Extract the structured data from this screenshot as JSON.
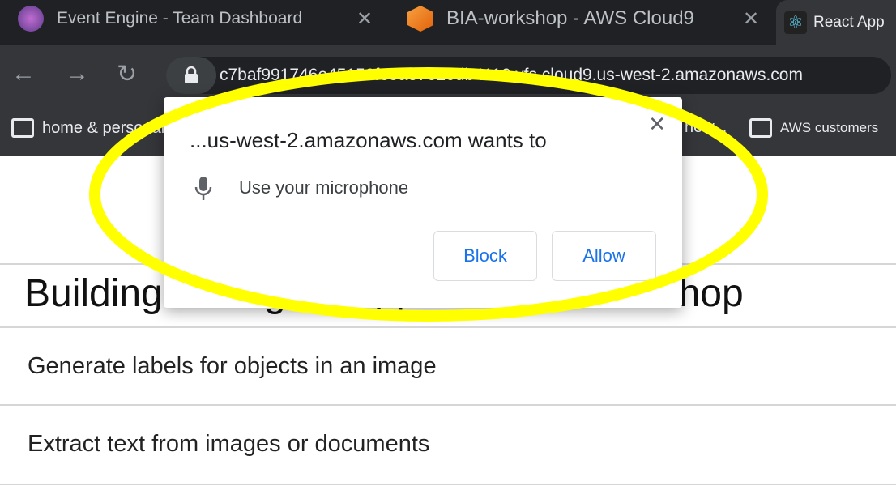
{
  "tabs": [
    {
      "title": "Event Engine - Team Dashboard",
      "icon": "event-engine-favicon"
    },
    {
      "title": "BIA-workshop - AWS Cloud9",
      "icon": "cloud9-favicon"
    },
    {
      "title": "React App",
      "icon": "react-favicon",
      "active": true
    }
  ],
  "address_bar": {
    "url": "c7baf991746e45159fe5ae7610db4116.vfs.cloud9.us-west-2.amazonaws.com"
  },
  "bookmarks": [
    {
      "label": "home & personal"
    },
    {
      "label": "new..."
    },
    {
      "label": "AWS customers"
    }
  ],
  "page": {
    "heading": "Building Intelligent Applications Workshop",
    "items": [
      "Generate labels for objects in an image",
      "Extract text from images or documents"
    ]
  },
  "permission_popup": {
    "title": "...us-west-2.amazonaws.com wants to",
    "request": "Use your microphone",
    "block_label": "Block",
    "allow_label": "Allow"
  },
  "colors": {
    "highlight": "#ffff00",
    "button_text": "#1a73e8",
    "chrome_dark": "#202124",
    "chrome_toolbar": "#35363a"
  }
}
